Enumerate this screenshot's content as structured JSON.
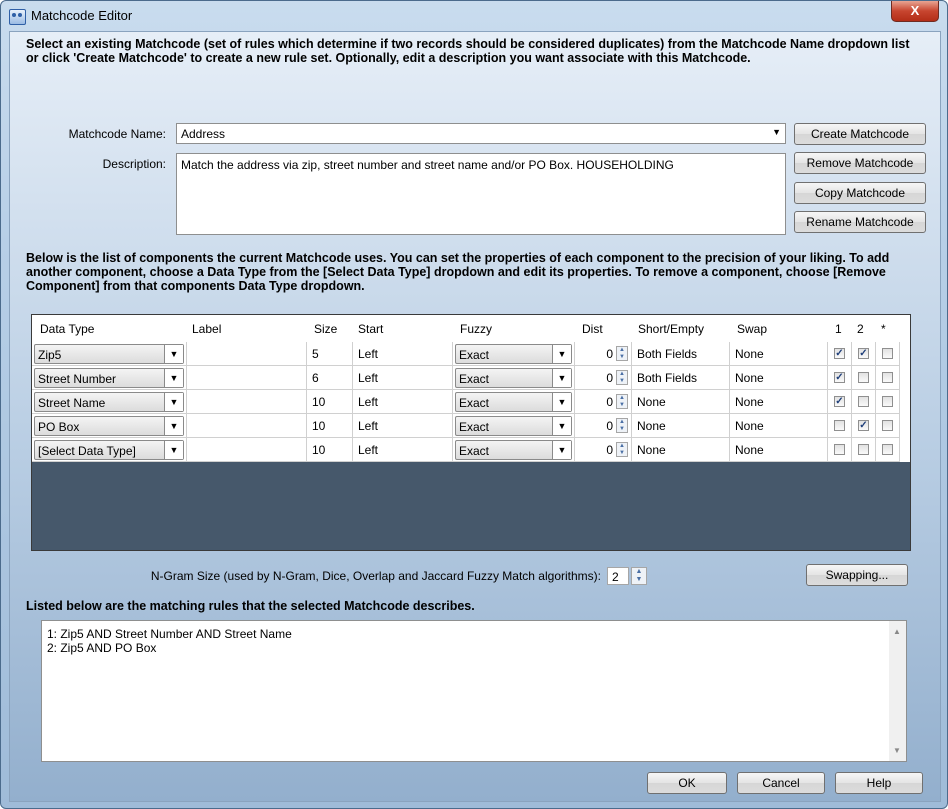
{
  "window": {
    "title": "Matchcode Editor",
    "close_glyph": "X"
  },
  "intro_text": "Select an existing Matchcode (set of rules which determine if two records should be considered duplicates) from the Matchcode Name dropdown list or click 'Create Matchcode' to create a new rule set. Optionally, edit a description you want associate with this Matchcode.",
  "matchcode": {
    "name_label": "Matchcode Name:",
    "name_value": "Address",
    "description_label": "Description:",
    "description_value": "Match the address via zip, street number and street name and/or PO Box. HOUSEHOLDING"
  },
  "buttons": {
    "create": "Create Matchcode",
    "remove": "Remove Matchcode",
    "copy": "Copy Matchcode",
    "rename": "Rename Matchcode",
    "swapping": "Swapping...",
    "ok": "OK",
    "cancel": "Cancel",
    "help": "Help"
  },
  "components_text": "Below is the list of components the current Matchcode uses. You can set the properties of each component to the precision of your liking. To add another component, choose a Data Type from the [Select Data Type] dropdown and edit its properties. To remove a component, choose [Remove Component] from that components Data Type dropdown.",
  "grid": {
    "headers": [
      "Data Type",
      "Label",
      "Size",
      "Start",
      "Fuzzy",
      "Dist",
      "Short/Empty",
      "Swap",
      "1",
      "2",
      "*"
    ],
    "rows": [
      {
        "data_type": "Zip5",
        "label": "",
        "size": "5",
        "start": "Left",
        "fuzzy": "Exact",
        "dist": "0",
        "short_empty": "Both Fields",
        "swap": "None",
        "c1": true,
        "c2": true,
        "c3": false
      },
      {
        "data_type": "Street Number",
        "label": "",
        "size": "6",
        "start": "Left",
        "fuzzy": "Exact",
        "dist": "0",
        "short_empty": "Both Fields",
        "swap": "None",
        "c1": true,
        "c2": false,
        "c3": false
      },
      {
        "data_type": "Street Name",
        "label": "",
        "size": "10",
        "start": "Left",
        "fuzzy": "Exact",
        "dist": "0",
        "short_empty": "None",
        "swap": "None",
        "c1": true,
        "c2": false,
        "c3": false
      },
      {
        "data_type": "PO Box",
        "label": "",
        "size": "10",
        "start": "Left",
        "fuzzy": "Exact",
        "dist": "0",
        "short_empty": "None",
        "swap": "None",
        "c1": false,
        "c2": true,
        "c3": false
      },
      {
        "data_type": "[Select Data Type]",
        "label": "",
        "size": "10",
        "start": "Left",
        "fuzzy": "Exact",
        "dist": "0",
        "short_empty": "None",
        "swap": "None",
        "c1": false,
        "c2": false,
        "c3": false
      }
    ]
  },
  "ngram": {
    "label": "N-Gram Size (used by N-Gram, Dice, Overlap and Jaccard Fuzzy Match algorithms):",
    "value": "2"
  },
  "rules_heading": "Listed below are the matching rules that the selected Matchcode describes.",
  "rules": [
    "1: Zip5 AND Street Number AND Street Name",
    "2: Zip5 AND PO Box"
  ],
  "icons": {
    "app": "matchcode-editor-app-icon",
    "dropdown": "chevron-down-icon",
    "spin": "spinner-arrows-icon",
    "check": "checkmark-icon"
  },
  "colors": {
    "grid_background": "#46586b",
    "close_button": "#c7452f",
    "check_color": "#1f3f7a"
  }
}
